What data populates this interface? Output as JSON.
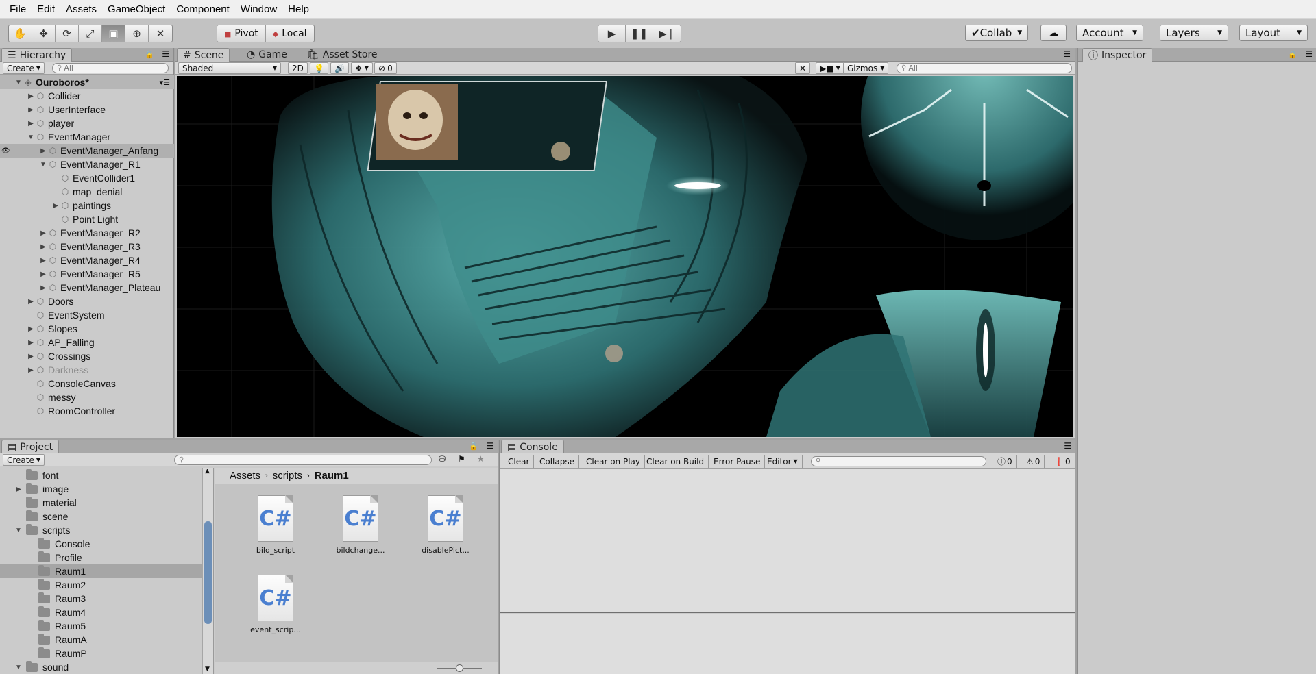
{
  "menu": [
    "File",
    "Edit",
    "Assets",
    "GameObject",
    "Component",
    "Window",
    "Help"
  ],
  "toolbar": {
    "transform_tools": [
      "hand-icon",
      "move-icon",
      "rotate-icon",
      "scale-icon",
      "rect-icon",
      "transform-icon",
      "custom-tool-icon"
    ],
    "pivot_label": "Pivot",
    "local_label": "Local",
    "collab_label": "Collab",
    "account_label": "Account",
    "layers_label": "Layers",
    "layout_label": "Layout"
  },
  "hierarchy": {
    "tab_label": "Hierarchy",
    "create_label": "Create",
    "search_placeholder": "All",
    "scene_name": "Ouroboros*",
    "items": [
      {
        "label": "Collider",
        "depth": 1,
        "expand": "collapsed"
      },
      {
        "label": "UserInterface",
        "depth": 1,
        "expand": "collapsed"
      },
      {
        "label": "player",
        "depth": 1,
        "expand": "collapsed"
      },
      {
        "label": "EventManager",
        "depth": 1,
        "expand": "expanded"
      },
      {
        "label": "EventManager_Anfang",
        "depth": 2,
        "expand": "collapsed",
        "selected": true
      },
      {
        "label": "EventManager_R1",
        "depth": 2,
        "expand": "expanded"
      },
      {
        "label": "EventCollider1",
        "depth": 3,
        "expand": "none"
      },
      {
        "label": "map_denial",
        "depth": 3,
        "expand": "none"
      },
      {
        "label": "paintings",
        "depth": 3,
        "expand": "collapsed"
      },
      {
        "label": "Point Light",
        "depth": 3,
        "expand": "none"
      },
      {
        "label": "EventManager_R2",
        "depth": 2,
        "expand": "collapsed"
      },
      {
        "label": "EventManager_R3",
        "depth": 2,
        "expand": "collapsed"
      },
      {
        "label": "EventManager_R4",
        "depth": 2,
        "expand": "collapsed"
      },
      {
        "label": "EventManager_R5",
        "depth": 2,
        "expand": "collapsed"
      },
      {
        "label": "EventManager_Plateau",
        "depth": 2,
        "expand": "collapsed"
      },
      {
        "label": "Doors",
        "depth": 1,
        "expand": "collapsed"
      },
      {
        "label": "EventSystem",
        "depth": 1,
        "expand": "none"
      },
      {
        "label": "Slopes",
        "depth": 1,
        "expand": "collapsed"
      },
      {
        "label": "AP_Falling",
        "depth": 1,
        "expand": "collapsed"
      },
      {
        "label": "Crossings",
        "depth": 1,
        "expand": "collapsed"
      },
      {
        "label": "Darkness",
        "depth": 1,
        "expand": "collapsed",
        "dim": true
      },
      {
        "label": "ConsoleCanvas",
        "depth": 1,
        "expand": "none"
      },
      {
        "label": "messy",
        "depth": 1,
        "expand": "none"
      },
      {
        "label": "RoomController",
        "depth": 1,
        "expand": "none"
      }
    ]
  },
  "scene": {
    "tabs": [
      {
        "label": "Scene",
        "icon": "grid-icon"
      },
      {
        "label": "Game",
        "icon": "pacman-icon"
      },
      {
        "label": "Asset Store",
        "icon": "store-icon"
      }
    ],
    "shading_mode": "Shaded",
    "mode_2d": "2D",
    "hidden_count": "0",
    "gizmos_label": "Gizmos",
    "search_placeholder": "All"
  },
  "inspector": {
    "tab_label": "Inspector"
  },
  "project": {
    "tab_label": "Project",
    "create_label": "Create",
    "breadcrumb": [
      "Assets",
      "scripts",
      "Raum1"
    ],
    "folders": [
      {
        "label": "font",
        "depth": 1,
        "expand": "none"
      },
      {
        "label": "image",
        "depth": 1,
        "expand": "collapsed"
      },
      {
        "label": "material",
        "depth": 1,
        "expand": "none"
      },
      {
        "label": "scene",
        "depth": 1,
        "expand": "none"
      },
      {
        "label": "scripts",
        "depth": 1,
        "expand": "expanded"
      },
      {
        "label": "Console",
        "depth": 2,
        "expand": "none"
      },
      {
        "label": "Profile",
        "depth": 2,
        "expand": "none"
      },
      {
        "label": "Raum1",
        "depth": 2,
        "expand": "none",
        "selected": true
      },
      {
        "label": "Raum2",
        "depth": 2,
        "expand": "none"
      },
      {
        "label": "Raum3",
        "depth": 2,
        "expand": "none"
      },
      {
        "label": "Raum4",
        "depth": 2,
        "expand": "none"
      },
      {
        "label": "Raum5",
        "depth": 2,
        "expand": "none"
      },
      {
        "label": "RaumA",
        "depth": 2,
        "expand": "none"
      },
      {
        "label": "RaumP",
        "depth": 2,
        "expand": "none"
      },
      {
        "label": "sound",
        "depth": 1,
        "expand": "expanded"
      }
    ],
    "assets": [
      {
        "label": "bild_script",
        "icon_text": "C#"
      },
      {
        "label": "bildchange...",
        "icon_text": "C#"
      },
      {
        "label": "disablePict...",
        "icon_text": "C#"
      },
      {
        "label": "event_scrip...",
        "icon_text": "C#"
      }
    ]
  },
  "console": {
    "tab_label": "Console",
    "buttons": [
      "Clear",
      "Collapse",
      "Clear on Play",
      "Clear on Build",
      "Error Pause",
      "Editor"
    ],
    "info_count": "0",
    "warning_count": "0",
    "error_count": "0"
  }
}
